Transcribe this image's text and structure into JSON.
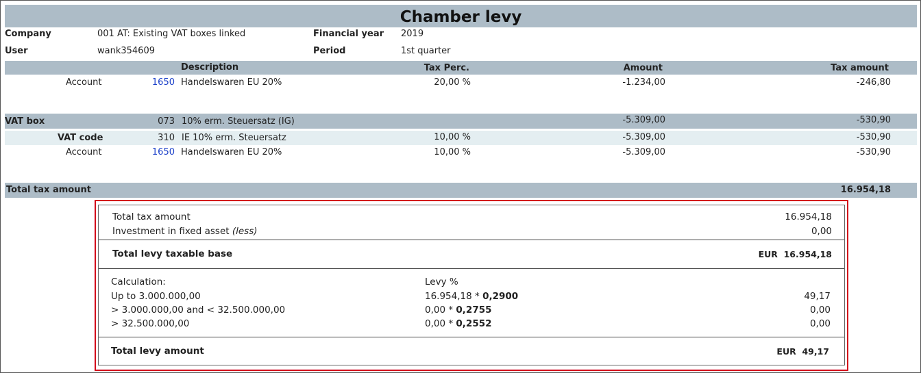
{
  "title": "Chamber levy",
  "meta": {
    "company_label": "Company",
    "company_value": "001 AT: Existing VAT boxes linked",
    "user_label": "User",
    "user_value": "wank354609",
    "year_label": "Financial year",
    "year_value": "2019",
    "period_label": "Period",
    "period_value": "1st quarter"
  },
  "columns": {
    "description": "Description",
    "tax_perc": "Tax Perc.",
    "amount": "Amount",
    "tax_amount": "Tax amount"
  },
  "rows": [
    {
      "label": "Account",
      "code": "1650",
      "description": "Handelswaren EU 20%",
      "tax_perc": "20,00 %",
      "amount": "-1.234,00",
      "tax_amount": "-246,80"
    },
    {
      "label": "VAT box",
      "code": "073",
      "description": "10% erm. Steuersatz (IG)",
      "tax_perc": "",
      "amount": "-5.309,00",
      "tax_amount": "-530,90"
    },
    {
      "label": "VAT code",
      "code": "310",
      "description": "IE 10% erm. Steuersatz",
      "tax_perc": "10,00 %",
      "amount": "-5.309,00",
      "tax_amount": "-530,90"
    },
    {
      "label": "Account",
      "code": "1650",
      "description": "Handelswaren EU 20%",
      "tax_perc": "10,00 %",
      "amount": "-5.309,00",
      "tax_amount": "-530,90"
    }
  ],
  "total": {
    "label": "Total tax amount",
    "value": "16.954,18"
  },
  "levy": {
    "total_tax_label": "Total tax amount",
    "total_tax_value": "16.954,18",
    "investment_label": "Investment in fixed asset",
    "investment_note": "(less)",
    "investment_value": "0,00",
    "base_label": "Total levy taxable base",
    "base_currency": "EUR",
    "base_value": "16.954,18",
    "calc_label": "Calculation:",
    "levy_pct_label": "Levy %",
    "brackets": [
      {
        "range": "Up to 3.000.000,00",
        "base": "16.954,18",
        "factor": "0,2900",
        "result": "49,17"
      },
      {
        "range": "> 3.000.000,00 and < 32.500.000,00",
        "base": "0,00",
        "factor": "0,2755",
        "result": "0,00"
      },
      {
        "range": "> 32.500.000,00",
        "base": "0,00",
        "factor": "0,2552",
        "result": "0,00"
      }
    ],
    "total_levy_label": "Total levy amount",
    "total_levy_currency": "EUR",
    "total_levy_value": "49,17"
  }
}
